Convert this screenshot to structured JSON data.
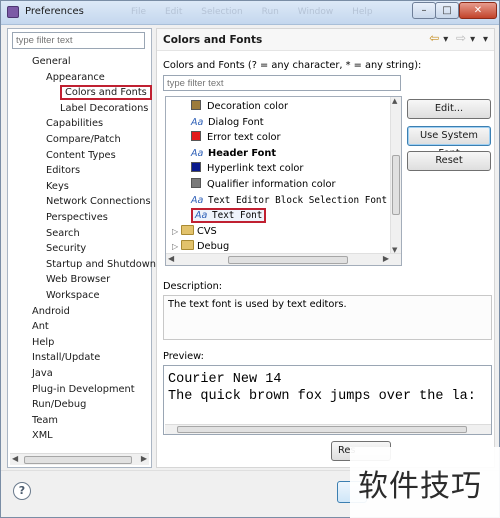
{
  "window": {
    "title": "Preferences",
    "ghost_menu": [
      "File",
      "Edit",
      "Selection",
      "Run",
      "Window",
      "Help"
    ]
  },
  "left": {
    "filter_placeholder": "type filter text",
    "tree": [
      {
        "label": "General",
        "depth": 1
      },
      {
        "label": "Appearance",
        "depth": 2
      },
      {
        "label": "Colors and Fonts",
        "depth": 3,
        "selected": true
      },
      {
        "label": "Label Decorations",
        "depth": 3
      },
      {
        "label": "Capabilities",
        "depth": 2
      },
      {
        "label": "Compare/Patch",
        "depth": 2
      },
      {
        "label": "Content Types",
        "depth": 2
      },
      {
        "label": "Editors",
        "depth": 2
      },
      {
        "label": "Keys",
        "depth": 2
      },
      {
        "label": "Network Connections",
        "depth": 2
      },
      {
        "label": "Perspectives",
        "depth": 2
      },
      {
        "label": "Search",
        "depth": 2
      },
      {
        "label": "Security",
        "depth": 2
      },
      {
        "label": "Startup and Shutdown",
        "depth": 2
      },
      {
        "label": "Web Browser",
        "depth": 2
      },
      {
        "label": "Workspace",
        "depth": 2
      },
      {
        "label": "Android",
        "depth": 1
      },
      {
        "label": "Ant",
        "depth": 1
      },
      {
        "label": "Help",
        "depth": 1
      },
      {
        "label": "Install/Update",
        "depth": 1
      },
      {
        "label": "Java",
        "depth": 1
      },
      {
        "label": "Plug-in Development",
        "depth": 1
      },
      {
        "label": "Run/Debug",
        "depth": 1
      },
      {
        "label": "Team",
        "depth": 1
      },
      {
        "label": "XML",
        "depth": 1
      }
    ]
  },
  "right": {
    "page_title": "Colors and Fonts",
    "section_label": "Colors and Fonts (? = any character, * = any string):",
    "filter_placeholder": "type filter text",
    "items": [
      {
        "label": "Decoration color",
        "icon": "color-swatch-icon",
        "color": "#9c7b3c"
      },
      {
        "label": "Dialog Font",
        "icon": "font-icon"
      },
      {
        "label": "Error text color",
        "icon": "color-swatch-icon",
        "color": "#e31b1b"
      },
      {
        "label": "Header Font",
        "icon": "font-icon",
        "bold": true
      },
      {
        "label": "Hyperlink text color",
        "icon": "color-swatch-icon",
        "color": "#0a1a8c"
      },
      {
        "label": "Qualifier information color",
        "icon": "color-swatch-icon",
        "color": "#7a7a7a"
      },
      {
        "label": "Text Editor Block Selection Font",
        "icon": "font-icon",
        "mono": true
      },
      {
        "label": "Text Font",
        "icon": "font-icon",
        "mono": true,
        "selected": true
      },
      {
        "label": "CVS",
        "icon": "folder-icon",
        "expandable": true
      },
      {
        "label": "Debug",
        "icon": "folder-icon",
        "expandable": true
      }
    ],
    "font_icon_glyph": "Aa",
    "buttons": {
      "edit": "Edit...",
      "use_system_font": "Use System Font",
      "reset": "Reset"
    },
    "description_label": "Description:",
    "description_text": "The text font is used by text editors.",
    "preview_label": "Preview:",
    "preview_lines": [
      "Courier New 14",
      "The quick brown fox jumps over the la:"
    ],
    "restore_button": "Res"
  },
  "footer": {
    "help_glyph": "?"
  },
  "watermark": "软件技巧"
}
